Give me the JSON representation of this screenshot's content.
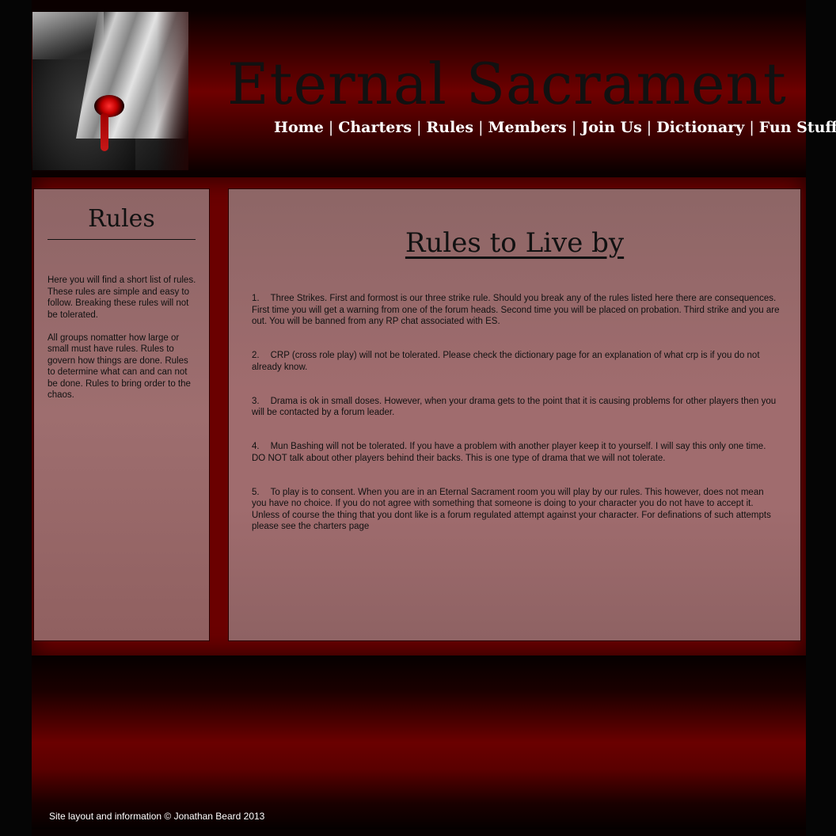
{
  "header": {
    "title": "Eternal Sacrament",
    "nav": [
      "Home",
      "Charters",
      "Rules",
      "Members",
      "Join Us",
      "Dictionary",
      "Fun Stuff"
    ]
  },
  "sidebar": {
    "title": "Rules",
    "paragraphs": [
      "Here you will find a short list of rules. These rules are simple and easy to follow. Breaking these rules will not be tolerated.",
      "All groups nomatter how large or small must have rules. Rules to govern how things are done. Rules to determine what can and can not be done. Rules to bring order to the chaos."
    ]
  },
  "main": {
    "title": "Rules to Live by",
    "rules": [
      {
        "num": "1.",
        "text": "Three Strikes. First and formost is our three strike rule. Should you break any of the rules listed here there are consequences. First time you will get a warning from one of the forum heads. Second time you will be placed on probation. Third strike and you are out. You will be banned from any RP chat associated with ES."
      },
      {
        "num": "2.",
        "text": "CRP (cross role play) will not be tolerated. Please check the dictionary page for an explanation of what crp is if you do not already know."
      },
      {
        "num": "3.",
        "text": "Drama is ok in small doses. However, when your drama gets to the point that it is causing problems for other players then you will be contacted by a forum leader."
      },
      {
        "num": "4.",
        "text": "Mun Bashing will not be tolerated. If you have a problem with another player keep it to yourself. I will say this only one time. DO NOT talk about other players behind their backs. This is one type of drama that we will not tolerate."
      },
      {
        "num": "5.",
        "text": "To play is to consent. When you are in an Eternal Sacrament room you will play by our rules. This however, does not mean you have no choice. If you do not agree with something that someone is doing to your character you do not have to accept it. Unless of course the thing that you dont like is a forum regulated attempt against your character. For definations of such attempts please see the charters page"
      }
    ]
  },
  "footer": {
    "copyright": "Site layout and information © Jonathan Beard 2013"
  }
}
